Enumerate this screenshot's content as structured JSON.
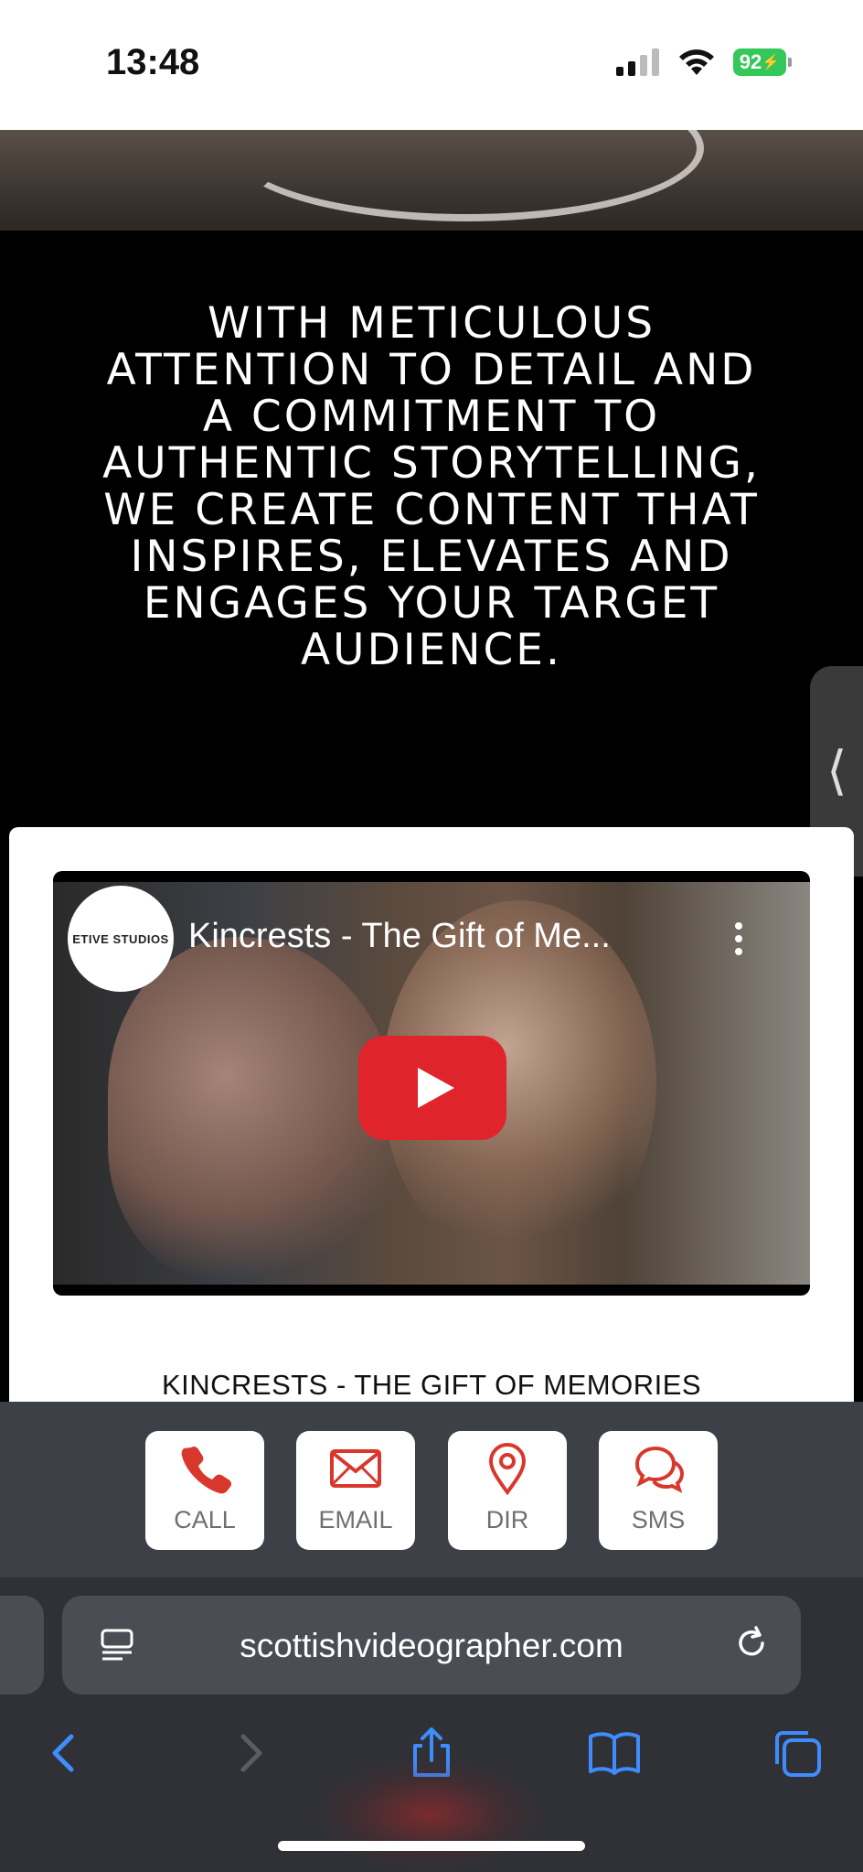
{
  "status": {
    "time": "13:48",
    "battery": "92"
  },
  "hero": {
    "headline": "WITH METICULOUS ATTENTION TO DETAIL AND A COMMITMENT TO AUTHENTIC STORYTELLING, WE CREATE CONTENT THAT INSPIRES, ELEVATES AND ENGAGES YOUR TARGET AUDIENCE."
  },
  "video": {
    "channel_logo_text": "ETIVE STUDIOS",
    "title": "Kincrests - The Gift of Me...",
    "caption": "KINCRESTS - THE GIFT OF MEMORIES"
  },
  "actions": [
    {
      "label": "CALL",
      "icon": "phone-icon"
    },
    {
      "label": "EMAIL",
      "icon": "envelope-icon"
    },
    {
      "label": "DIR",
      "icon": "map-pin-icon"
    },
    {
      "label": "SMS",
      "icon": "chat-bubbles-icon"
    }
  ],
  "browser": {
    "url": "scottishvideographer.com"
  },
  "colors": {
    "accent_red": "#d8382c",
    "safari_blue": "#3f8cff",
    "battery_green": "#34c759"
  }
}
